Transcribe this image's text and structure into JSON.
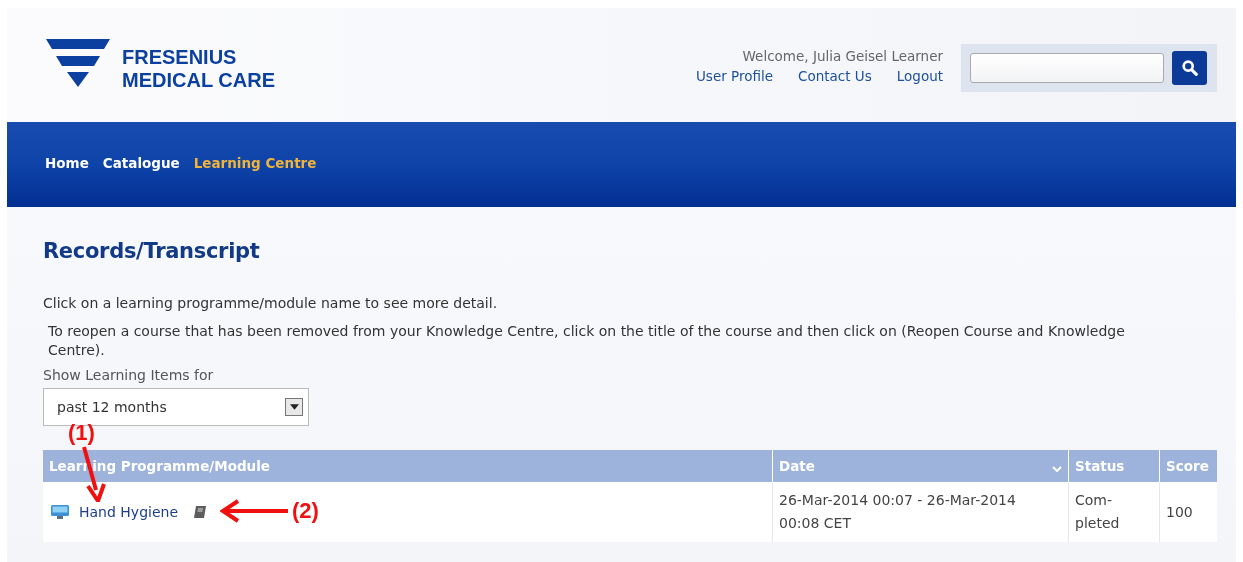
{
  "logo": {
    "line_1": "FRESENIUS",
    "line_2": "MEDICAL CARE"
  },
  "user_bar": {
    "welcome": "Welcome, Julia Geisel Learner",
    "links": [
      "User Profile",
      "Contact Us",
      "Logout"
    ]
  },
  "nav": [
    {
      "label": "Home",
      "selected": false
    },
    {
      "label": "Catalogue",
      "selected": false
    },
    {
      "label": "Learning Centre",
      "selected": true
    }
  ],
  "page_title": "Records/Transcript",
  "intro": "Click on a learning programme/module name to see more detail.",
  "reopen_note": "To reopen a course that has been removed from your Knowledge Centre, click on the title of the course and then click on (Reopen Course and Knowledge Centre).",
  "filter": {
    "label": "Show Learning Items for",
    "value": "past 12 months"
  },
  "table": {
    "columns": [
      {
        "label": "Learning Programme/Module",
        "sorted": false
      },
      {
        "label": "Date",
        "sorted": true
      },
      {
        "label": "Status",
        "sorted": false
      },
      {
        "label": "Score",
        "sorted": false
      }
    ],
    "rows": [
      {
        "name": "Hand Hygiene",
        "date": "26-Mar-2014 00:07 - 26-Mar-2014 00:08 CET",
        "status": "Com-pleted",
        "score": "100"
      }
    ]
  },
  "annotations": [
    {
      "label": "(1)",
      "kind": "down"
    },
    {
      "label": "(2)",
      "kind": "left"
    }
  ]
}
